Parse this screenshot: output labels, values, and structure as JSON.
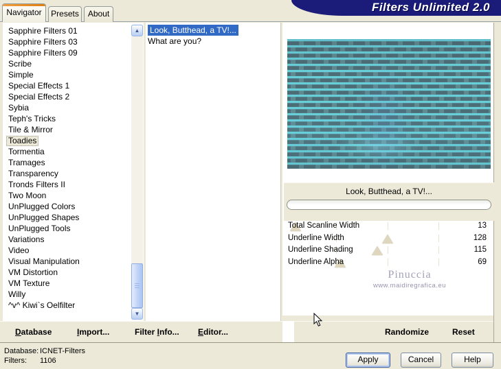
{
  "window": {
    "title": "Filters Unlimited 2.0"
  },
  "tabs": [
    {
      "label": "Navigator",
      "active": true
    },
    {
      "label": "Presets",
      "active": false
    },
    {
      "label": "About",
      "active": false
    }
  ],
  "sidebar": {
    "items": [
      "Sapphire Filters 01",
      "Sapphire Filters 03",
      "Sapphire Filters 09",
      "Scribe",
      "Simple",
      "Special Effects 1",
      "Special Effects 2",
      "Sybia",
      "Teph's Tricks",
      "Tile & Mirror",
      "Toadies",
      "Tormentia",
      "Tramages",
      "Transparency",
      "Tronds Filters II",
      "Two Moon",
      "UnPlugged Colors",
      "UnPlugged Shapes",
      "UnPlugged Tools",
      "Variations",
      "Video",
      "Visual Manipulation",
      "VM Distortion",
      "VM Texture",
      "Willy",
      "^v^ Kiwi`s Oelfilter"
    ],
    "selected_index": 10
  },
  "filter_list": {
    "items": [
      "Look, Butthead, a TV!...",
      "What are you?"
    ],
    "selected_index": 0
  },
  "preview": {
    "caption": "Look, Butthead, a TV!...",
    "colors": {
      "stripe": "#68cfd9",
      "band": "#5f8a92",
      "dash": "#4d6d76"
    }
  },
  "parameters": [
    {
      "label": "Total Scanline Width",
      "value": 13,
      "max": 255
    },
    {
      "label": "Underline Width",
      "value": 128,
      "max": 255
    },
    {
      "label": "Underline Shading",
      "value": 115,
      "max": 255
    },
    {
      "label": "Underline Alpha",
      "value": 69,
      "max": 255
    }
  ],
  "watermark": {
    "line1": "Pinuccia",
    "line2": "www.maidiregrafica.eu"
  },
  "command_bar": {
    "left": [
      {
        "label": "Database",
        "mnemonic": 0
      },
      {
        "label": "Import...",
        "mnemonic": 0
      },
      {
        "label": "Filter Info...",
        "mnemonic": 7
      },
      {
        "label": "Editor...",
        "mnemonic": 0
      }
    ],
    "right": [
      {
        "label": "Randomize"
      },
      {
        "label": "Reset"
      }
    ]
  },
  "status": {
    "rows": [
      {
        "label": "Database:",
        "value": "ICNET-Filters"
      },
      {
        "label": "Filters:",
        "value": "1106"
      }
    ]
  },
  "dialog_buttons": [
    {
      "label": "Apply",
      "default": true
    },
    {
      "label": "Cancel",
      "default": false
    },
    {
      "label": "Help",
      "default": false
    }
  ],
  "colors": {
    "dialog_bg": "#ece9d8",
    "banner_bg": "#1b1b7a",
    "selection_blue": "#316ac5",
    "tab_accent_orange": "#e07f10"
  }
}
